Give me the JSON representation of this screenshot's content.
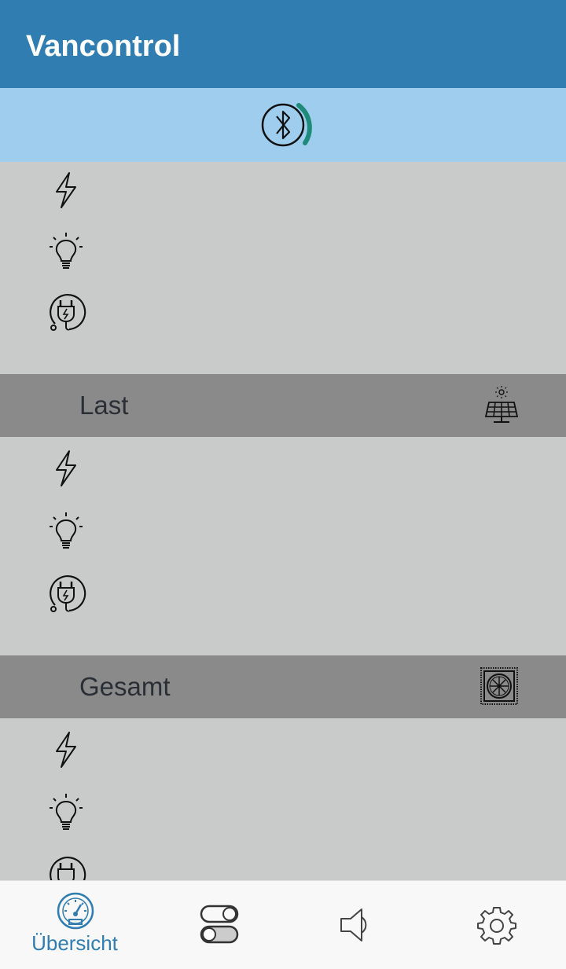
{
  "appbar": {
    "title": "Vancontrol"
  },
  "sections": [
    {
      "name": "",
      "header_icon": ""
    },
    {
      "name": "Last",
      "header_icon": "solar-panel-icon"
    },
    {
      "name": "Gesamt",
      "header_icon": "fan-vent-icon"
    }
  ],
  "row_icons": [
    "lightning-icon",
    "lightbulb-icon",
    "plug-icon"
  ],
  "bluetooth": {
    "icon": "bluetooth-icon",
    "signal_color": "#1e8a7a"
  },
  "bottom_nav": {
    "items": [
      {
        "label": "Übersicht",
        "icon": "speedometer-icon",
        "active": true
      },
      {
        "label": "",
        "icon": "toggle-switches-icon",
        "active": false
      },
      {
        "label": "",
        "icon": "speaker-icon",
        "active": false
      },
      {
        "label": "",
        "icon": "gear-icon",
        "active": false
      }
    ]
  },
  "colors": {
    "appbar": "#2f7db1",
    "bluetooth_bar": "#9ecded",
    "section_header": "#8a8a8a",
    "content_bg": "#c8cbca"
  }
}
